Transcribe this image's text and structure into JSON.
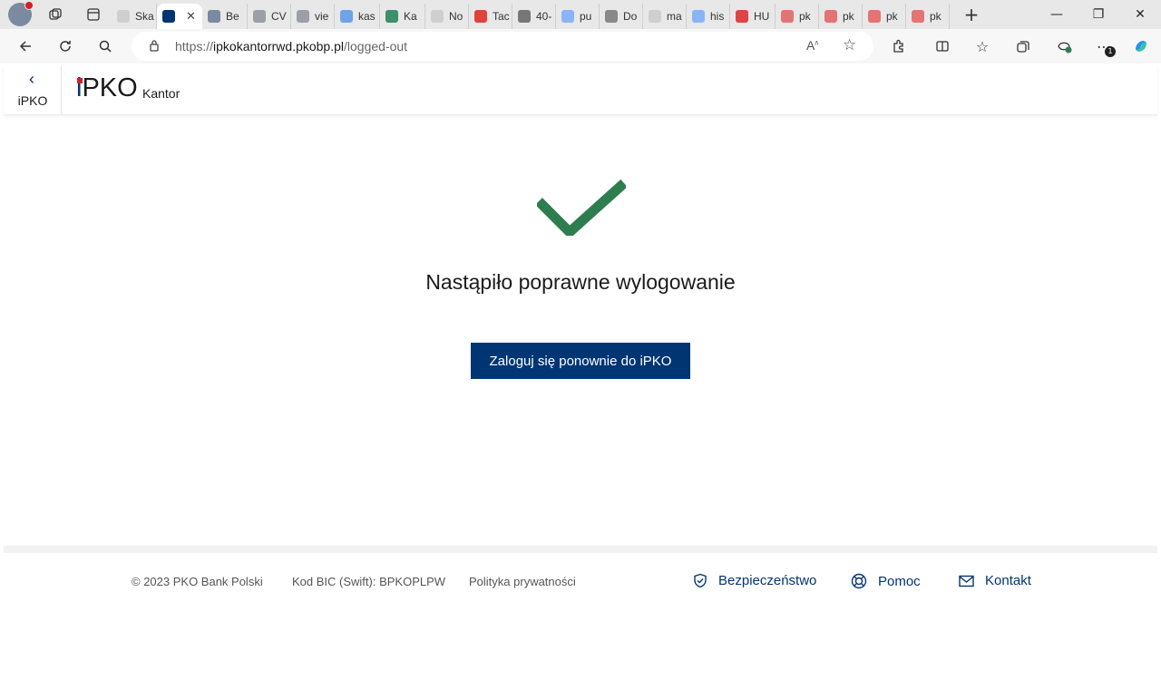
{
  "browser": {
    "tabs": [
      {
        "label": "Ska",
        "color": "#cfcfcf"
      },
      {
        "label": "",
        "color": "#003574",
        "active": true
      },
      {
        "label": "Be",
        "color": "#7b8aa0"
      },
      {
        "label": "CV",
        "color": "#9aa0a6"
      },
      {
        "label": "vie",
        "color": "#9aa0a6"
      },
      {
        "label": "kas",
        "color": "#6ea3e8"
      },
      {
        "label": "Ka",
        "color": "#3d8f6a"
      },
      {
        "label": "No",
        "color": "#cfcfcf"
      },
      {
        "label": "Tac",
        "color": "#e0413b"
      },
      {
        "label": "40-",
        "color": "#777777"
      },
      {
        "label": "pu",
        "color": "#8ab4f8"
      },
      {
        "label": "Do",
        "color": "#888888"
      },
      {
        "label": "ma",
        "color": "#cfcfcf"
      },
      {
        "label": "his",
        "color": "#8ab4f8"
      },
      {
        "label": "HU",
        "color": "#d44"
      },
      {
        "label": "pk",
        "color": "#e57373"
      },
      {
        "label": "pk",
        "color": "#e57373"
      },
      {
        "label": "pk",
        "color": "#e57373"
      },
      {
        "label": "pk",
        "color": "#e57373"
      }
    ],
    "url_prefix": "https://",
    "url_host": "ipkokantorrwd.pkobp.pl",
    "url_path": "/logged-out",
    "notification_count": "1"
  },
  "header": {
    "back_label": "iPKO",
    "logo_i": "i",
    "logo_text": "PKO",
    "subtitle": "Kantor"
  },
  "main": {
    "message": "Nastąpiło poprawne wylogowanie",
    "login_button": "Zaloguj się ponownie do iPKO",
    "check_color": "#2e7d4f"
  },
  "footer": {
    "copyright": "© 2023 PKO Bank Polski",
    "bic": "Kod BIC (Swift): BPKOPLPW",
    "privacy": "Polityka prywatności",
    "security": "Bezpieczeństwo",
    "help": "Pomoc",
    "contact": "Kontakt"
  },
  "colors": {
    "brand_navy": "#003574",
    "brand_red": "#d3202a"
  }
}
